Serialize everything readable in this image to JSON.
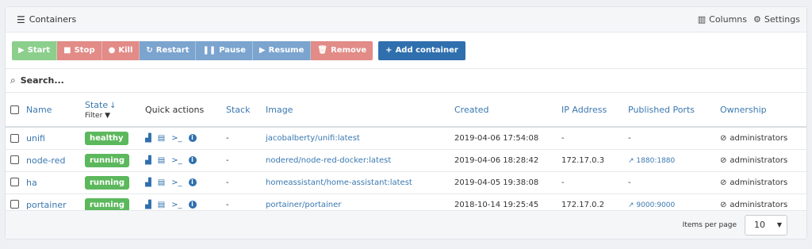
{
  "panel": {
    "title": "Containers",
    "title_icon": "table-icon"
  },
  "header": {
    "columns_label": "Columns",
    "settings_label": "Settings"
  },
  "toolbar": {
    "start": "Start",
    "stop": "Stop",
    "kill": "Kill",
    "restart": "Restart",
    "pause": "Pause",
    "resume": "Resume",
    "remove": "Remove",
    "add": "Add container"
  },
  "search": {
    "placeholder": "Search..."
  },
  "columns": {
    "name": "Name",
    "state": "State",
    "filter": "Filter",
    "quick_actions": "Quick actions",
    "stack": "Stack",
    "image": "Image",
    "created": "Created",
    "ip": "IP Address",
    "ports": "Published Ports",
    "ownership": "Ownership"
  },
  "rows": [
    {
      "name": "unifi",
      "state": "healthy",
      "stack": "-",
      "image": "jacobalberty/unifi:latest",
      "created": "2019-04-06 17:54:08",
      "ip": "-",
      "port": "-",
      "owner": "administrators"
    },
    {
      "name": "node-red",
      "state": "running",
      "stack": "-",
      "image": "nodered/node-red-docker:latest",
      "created": "2019-04-06 18:28:42",
      "ip": "172.17.0.3",
      "port": "1880:1880",
      "owner": "administrators"
    },
    {
      "name": "ha",
      "state": "running",
      "stack": "-",
      "image": "homeassistant/home-assistant:latest",
      "created": "2019-04-05 19:38:08",
      "ip": "-",
      "port": "-",
      "owner": "administrators"
    },
    {
      "name": "portainer",
      "state": "running",
      "stack": "-",
      "image": "portainer/portainer",
      "created": "2018-10-14 19:25:45",
      "ip": "172.17.0.2",
      "port": "9000:9000",
      "owner": "administrators"
    }
  ],
  "footer": {
    "items_per_page_label": "Items per page",
    "items_per_page": "10"
  },
  "colors": {
    "running": "#5cb85c",
    "link": "#3a78b0",
    "primary": "#2f6fae"
  }
}
